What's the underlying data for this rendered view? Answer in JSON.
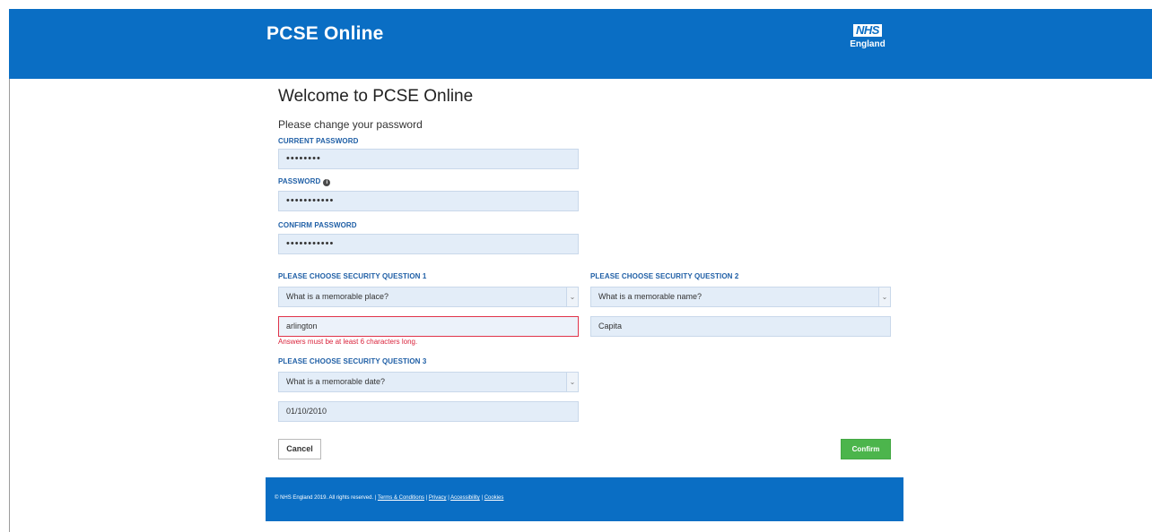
{
  "header": {
    "title": "PCSE Online",
    "logo_mark": "NHS",
    "logo_sub": "England",
    "bg_color": "#0a6ec4"
  },
  "main": {
    "heading": "Welcome to PCSE Online",
    "subheading": "Please change your password"
  },
  "form": {
    "current_password": {
      "label": "CURRENT PASSWORD",
      "value": "••••••••"
    },
    "password": {
      "label": "PASSWORD",
      "value": "•••••••••••",
      "info_icon": "info-icon"
    },
    "confirm_password": {
      "label": "CONFIRM PASSWORD",
      "value": "•••••••••••"
    },
    "question1": {
      "label": "PLEASE CHOOSE SECURITY QUESTION 1",
      "selected": "What is a memorable place?",
      "answer": "arlington",
      "error": "Answers must be at least 6 characters long."
    },
    "question2": {
      "label": "PLEASE CHOOSE SECURITY QUESTION 2",
      "selected": "What is a memorable name?",
      "answer": "Capita"
    },
    "question3": {
      "label": "PLEASE CHOOSE SECURITY QUESTION 3",
      "selected": "What is a memorable date?",
      "answer": "01/10/2010"
    },
    "cancel_label": "Cancel",
    "confirm_label": "Confirm",
    "error_color": "#d9233b",
    "confirm_color": "#4cb54c"
  },
  "footer": {
    "copyright": "© NHS England 2019. All rights reserved. | ",
    "links": [
      "Terms & Conditions",
      "Privacy",
      "Accessibility",
      "Cookies"
    ],
    "separator": " | "
  }
}
